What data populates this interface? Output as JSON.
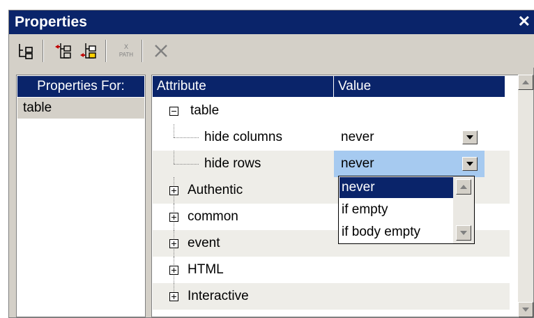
{
  "window": {
    "title": "Properties",
    "close_glyph": "✕"
  },
  "toolbar": {
    "icons": [
      "tree-view-icon",
      "insert-attribute-icon",
      "append-attribute-icon",
      "xpath-icon",
      "delete-icon"
    ],
    "xpath_label_top": "X",
    "xpath_label_bottom": "PATH"
  },
  "left_panel": {
    "header": "Properties For:",
    "items": [
      "table"
    ]
  },
  "grid": {
    "headers": {
      "attribute": "Attribute",
      "value": "Value"
    },
    "root": "table",
    "rows": [
      {
        "label": "hide columns",
        "value": "never"
      },
      {
        "label": "hide rows",
        "value": "never"
      }
    ],
    "groups": [
      "Authentic",
      "common",
      "event",
      "HTML",
      "Interactive"
    ]
  },
  "dropdown": {
    "options": [
      "never",
      "if empty",
      "if body empty"
    ],
    "selected": "never"
  },
  "colors": {
    "title_bg": "#0a246a",
    "selection_bg": "#a6caf0",
    "panel_bg": "#d4d0c8"
  }
}
